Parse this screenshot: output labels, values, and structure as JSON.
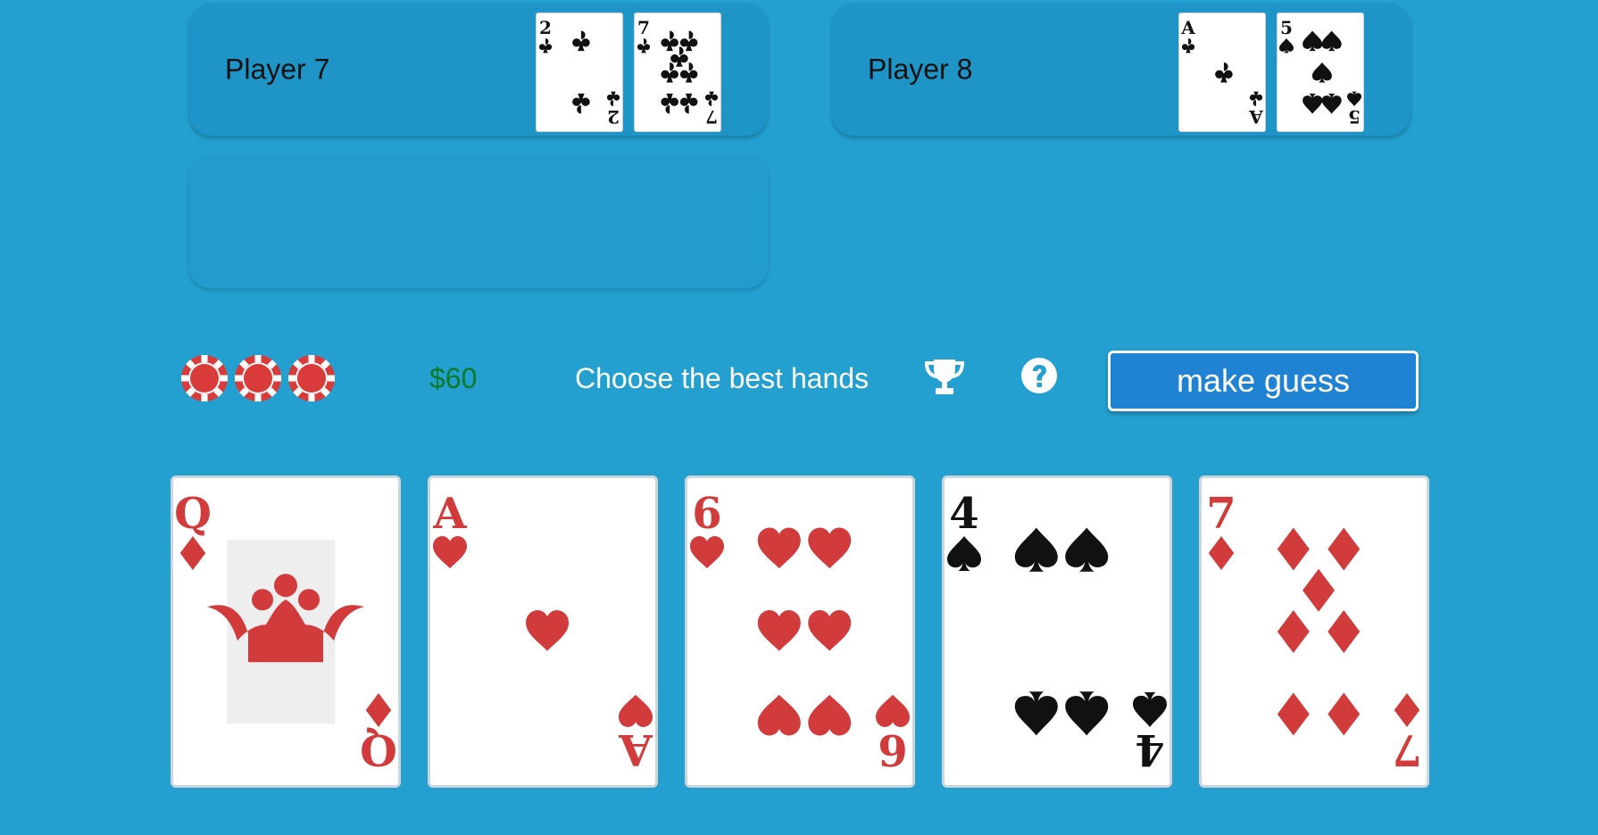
{
  "players": [
    {
      "name": "Player 7",
      "cards": [
        {
          "rank": "2",
          "suit": "clubs"
        },
        {
          "rank": "7",
          "suit": "clubs"
        }
      ]
    },
    {
      "name": "Player 8",
      "cards": [
        {
          "rank": "A",
          "suit": "clubs"
        },
        {
          "rank": "5",
          "suit": "spades"
        }
      ]
    }
  ],
  "controls": {
    "money": "$60",
    "instruction": "Choose the best hands",
    "guess_button_label": "make guess",
    "chips_count": 3,
    "trophy_icon": "trophy-icon",
    "help_icon": "question-circle-icon"
  },
  "board": [
    {
      "rank": "Q",
      "suit": "diamonds"
    },
    {
      "rank": "A",
      "suit": "hearts"
    },
    {
      "rank": "6",
      "suit": "hearts"
    },
    {
      "rank": "4",
      "suit": "spades"
    },
    {
      "rank": "7",
      "suit": "diamonds"
    }
  ],
  "colors": {
    "table": "#239fd0",
    "panel": "#1e95c6",
    "red_suit": "#d13b3b",
    "black_suit": "#111111",
    "money": "#0c7a26",
    "button": "#1f82d2",
    "chip": "#d93a3a"
  }
}
